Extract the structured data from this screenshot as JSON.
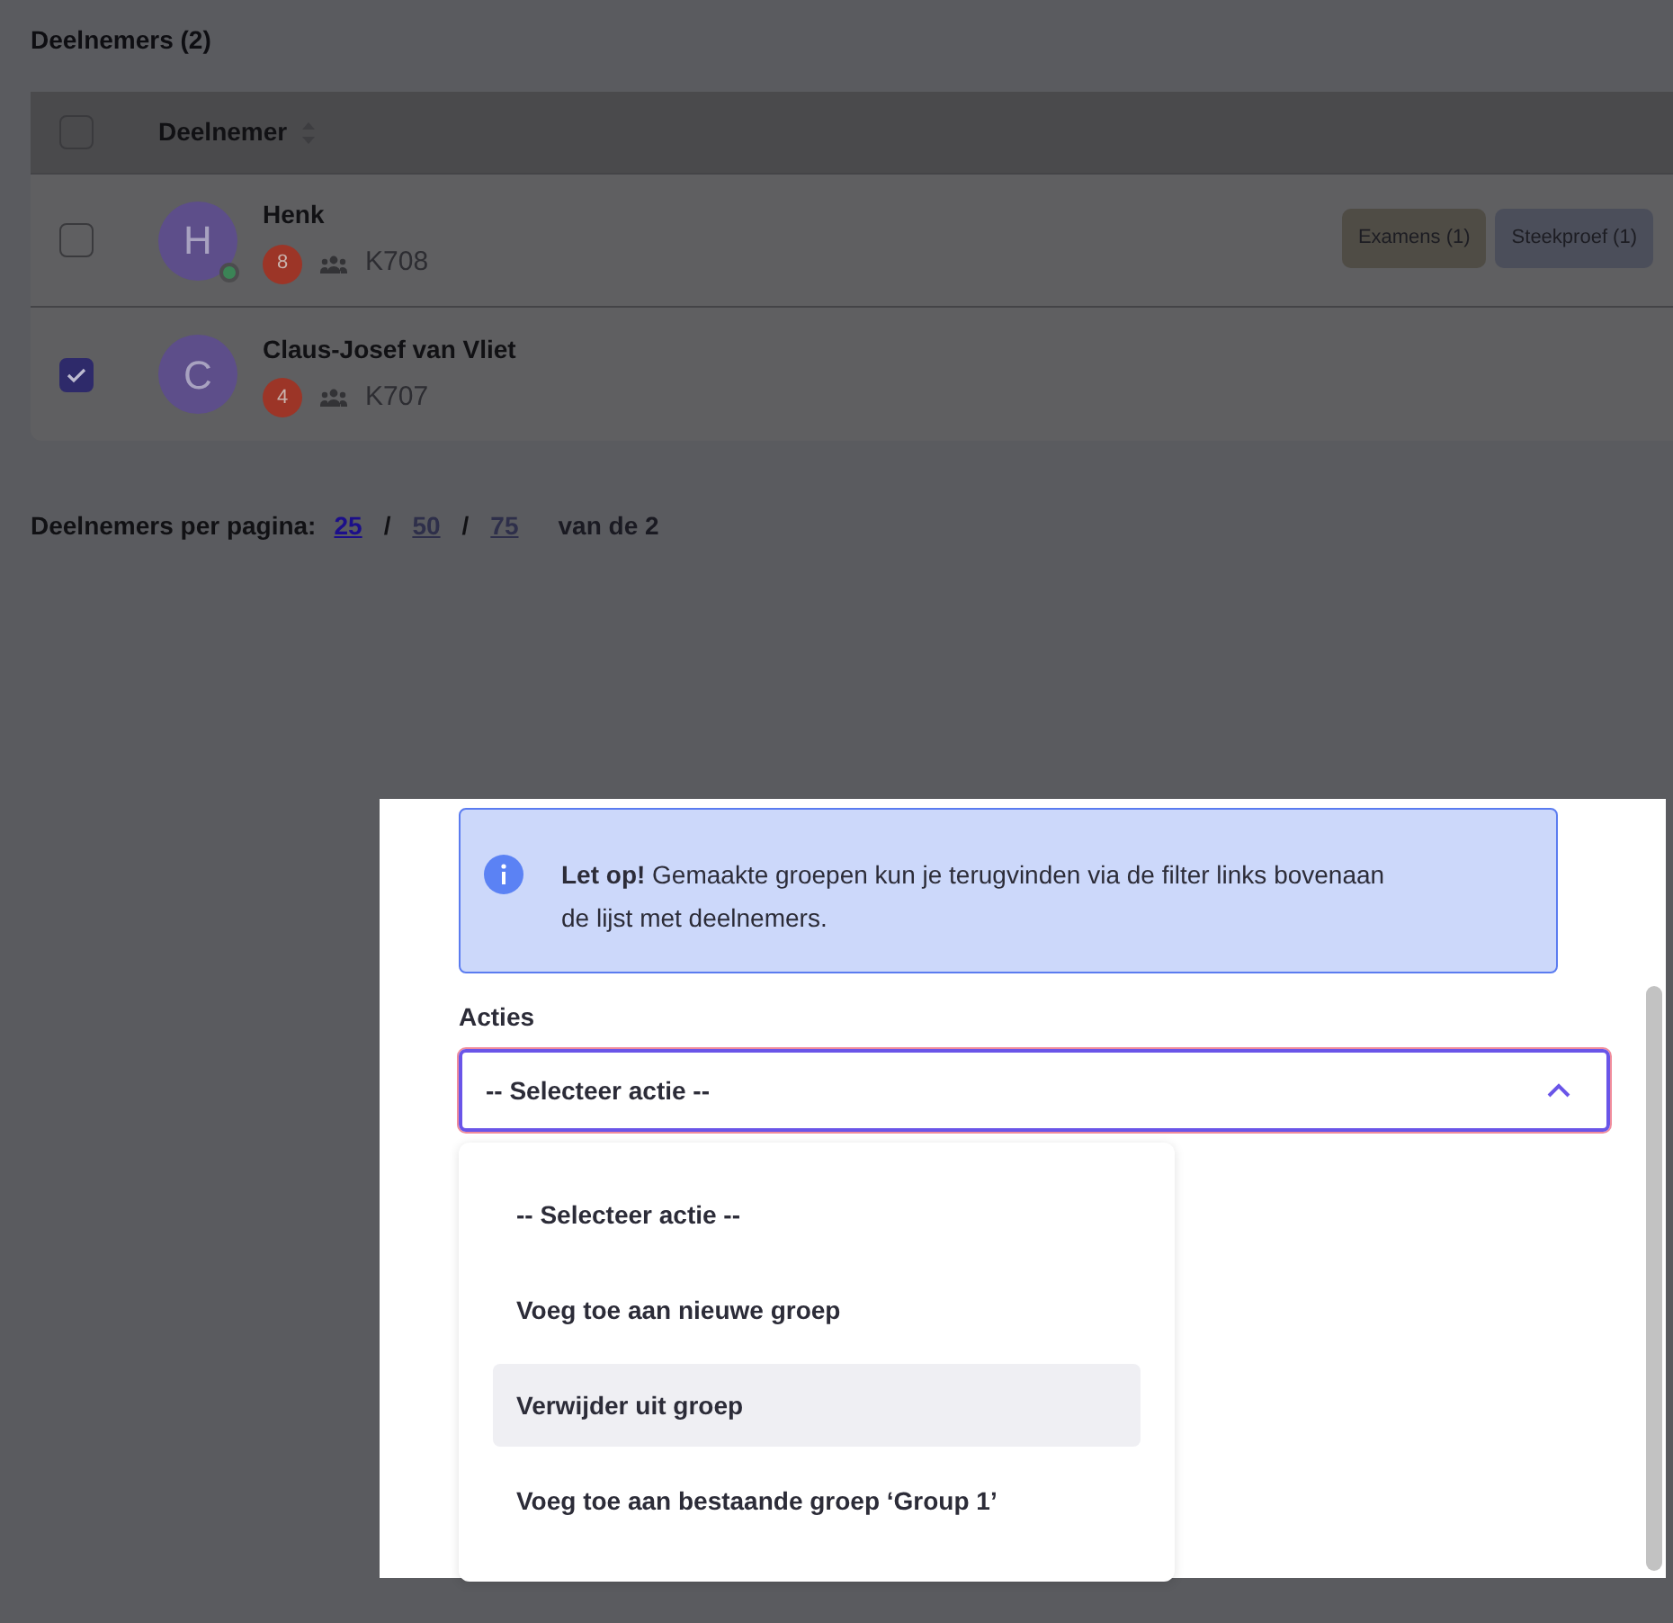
{
  "heading": "Deelnemers (2)",
  "table": {
    "select_all_checked": false,
    "column": "Deelnemer",
    "rows": [
      {
        "initial": "H",
        "name": "Henk",
        "online": true,
        "count": "8",
        "code": "K708",
        "checked": false,
        "tags": [
          {
            "label": "Examens (1)",
            "color": "#4f4c45"
          },
          {
            "label": "Steekproef (1)",
            "color": "#4b4e5a"
          }
        ]
      },
      {
        "initial": "C",
        "name": "Claus-Josef van Vliet",
        "online": false,
        "count": "4",
        "code": "K707",
        "checked": true,
        "tags": []
      }
    ]
  },
  "pagination": {
    "label": "Deelnemers per pagina:",
    "options": [
      {
        "label": "25",
        "selected": true
      },
      {
        "label": "50",
        "selected": false
      },
      {
        "label": "75",
        "selected": false
      }
    ],
    "separator": "/",
    "total": "van de 2"
  },
  "dialog": {
    "notice": "**Let op!** Gemaakte groepen kun je terugvinden via de filter links bovenaan de lijst met deelnemers.",
    "field_label": "Acties",
    "select_value": "-- Selecteer actie --",
    "expanded": true,
    "options": [
      {
        "label": "-- Selecteer actie --",
        "highlighted": false
      },
      {
        "label": "Voeg toe aan nieuwe groep",
        "highlighted": false
      },
      {
        "label": "Verwijder uit groep",
        "highlighted": true
      },
      {
        "label": "Voeg toe aan bestaande groep ‘Group 1’",
        "highlighted": false
      }
    ]
  }
}
